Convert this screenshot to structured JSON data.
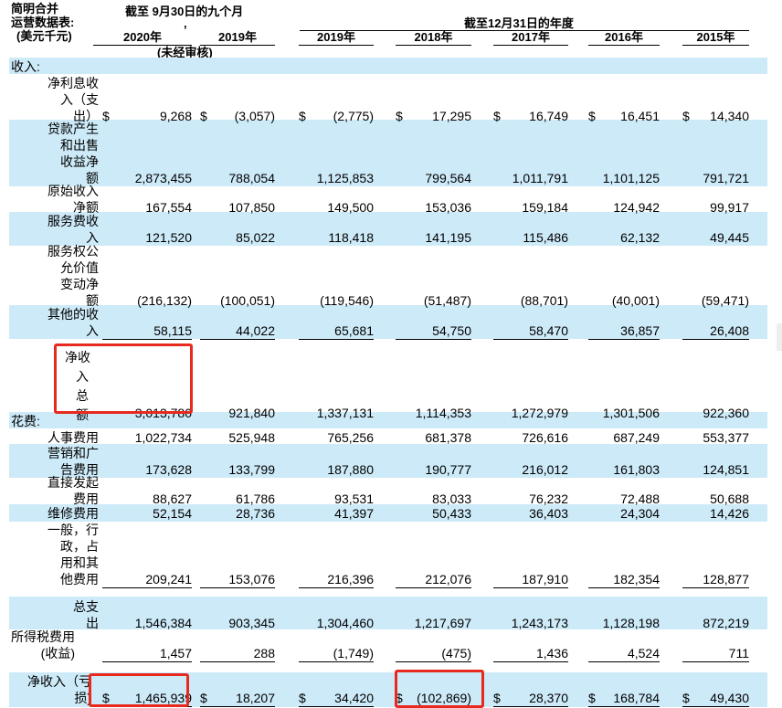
{
  "header": {
    "title_lines": [
      "简明合并",
      "运营数据表:",
      "(美元千元)"
    ],
    "group_nine_months": "截至 9月30日的九个月",
    "group_year_end": "截至12月31日的年度",
    "comma": ",",
    "unaudited": "(未经审核)",
    "columns": [
      "2020年",
      "2019年",
      "2019年",
      "2018年",
      "2017年",
      "2016年",
      "2015年"
    ]
  },
  "sections": {
    "revenue": "收入:",
    "expenses": "花费:"
  },
  "rows": {
    "net_interest": {
      "label": [
        "净利息收",
        "入（支",
        "出）"
      ],
      "values": [
        "9,268",
        "(3,057)",
        "(2,775)",
        "17,295",
        "16,749",
        "16,451",
        "14,340"
      ]
    },
    "loan_gain": {
      "label": [
        "贷款产生",
        "和出售",
        "收益净",
        "额"
      ],
      "values": [
        "2,873,455",
        "788,054",
        "1,125,853",
        "799,564",
        "1,011,791",
        "1,101,125",
        "791,721"
      ]
    },
    "origination": {
      "label": [
        "原始收入",
        "净额"
      ],
      "values": [
        "167,554",
        "107,850",
        "149,500",
        "153,036",
        "159,184",
        "124,942",
        "99,917"
      ]
    },
    "servicing_fee": {
      "label": [
        "服务费收",
        "入"
      ],
      "values": [
        "121,520",
        "85,022",
        "118,418",
        "141,195",
        "115,486",
        "62,132",
        "49,445"
      ]
    },
    "msr_fv": {
      "label": [
        "服务权公",
        "允价值",
        "变动净",
        "额"
      ],
      "values": [
        "(216,132)",
        "(100,051)",
        "(119,546)",
        "(51,487)",
        "(88,701)",
        "(40,001)",
        "(59,471)"
      ]
    },
    "other_income": {
      "label": [
        "其他的收",
        "入"
      ],
      "values": [
        "58,115",
        "44,022",
        "65,681",
        "54,750",
        "58,470",
        "36,857",
        "26,408"
      ]
    },
    "total_revenue": {
      "label": [
        "净收",
        "入",
        "总",
        "额"
      ],
      "values": [
        "3,013,780",
        "921,840",
        "1,337,131",
        "1,114,353",
        "1,272,979",
        "1,301,506",
        "922,360"
      ]
    },
    "personnel": {
      "label": [
        "人事费用"
      ],
      "values": [
        "1,022,734",
        "525,948",
        "765,256",
        "681,378",
        "726,616",
        "687,249",
        "553,377"
      ]
    },
    "marketing": {
      "label": [
        "营销和广",
        "告费用"
      ],
      "values": [
        "173,628",
        "133,799",
        "187,880",
        "190,777",
        "216,012",
        "161,803",
        "124,851"
      ]
    },
    "direct_orig": {
      "label": [
        "直接发起",
        "费用"
      ],
      "values": [
        "88,627",
        "61,786",
        "93,531",
        "83,033",
        "76,232",
        "72,488",
        "50,688"
      ]
    },
    "maintenance": {
      "label": [
        "维修费用"
      ],
      "values": [
        "52,154",
        "28,736",
        "41,397",
        "50,433",
        "36,403",
        "24,304",
        "14,426"
      ]
    },
    "general_admin": {
      "label": [
        "一般，行",
        "政，占",
        "用和其",
        "他费用"
      ],
      "values": [
        "209,241",
        "153,076",
        "216,396",
        "212,076",
        "187,910",
        "182,354",
        "128,877"
      ]
    },
    "total_expenses": {
      "label": [
        "总支",
        "出"
      ],
      "values": [
        "1,546,384",
        "903,345",
        "1,304,460",
        "1,217,697",
        "1,243,173",
        "1,128,198",
        "872,219"
      ]
    },
    "income_tax": {
      "label": [
        "所得税费用",
        "(收益)"
      ],
      "values": [
        "1,457",
        "288",
        "(1,749)",
        "(475)",
        "1,436",
        "4,524",
        "711"
      ]
    },
    "net_income": {
      "label": [
        "净收入（亏",
        "损)"
      ],
      "values": [
        "1,465,939",
        "18,207",
        "34,420",
        "(102,869)",
        "28,370",
        "168,784",
        "49,430"
      ]
    }
  },
  "dollar_sign": "$",
  "colors": {
    "band": "#cdeaf8",
    "highlight_box": "#e8291e"
  }
}
